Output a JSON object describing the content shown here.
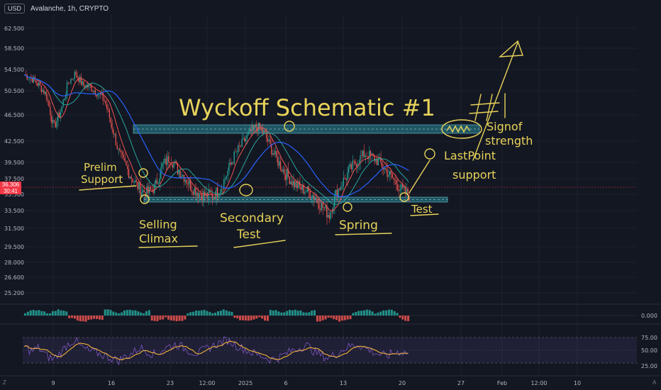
{
  "header": {
    "currency": "USD",
    "symbol_line": "Avalanche, 1h, CRYPTO"
  },
  "price_tag": {
    "value": "36.306",
    "countdown": "30:41"
  },
  "corner": {
    "left": "Z",
    "right": "A"
  },
  "colors": {
    "background": "#131722",
    "grid": "#1e222d",
    "annotation": "#e8d35a",
    "zone": "#2a8a9a",
    "ema": "#2962ff",
    "ma_teal": "#26a69a",
    "ma_red": "#ef5350",
    "rsi_line": "#7e57c2",
    "rsi_ma": "#f0b23a",
    "up": "#26a69a",
    "down": "#ef5350"
  },
  "chart_data": [
    {
      "type": "line",
      "title": "",
      "xlabel": "",
      "ylabel": "",
      "y_ticks": [
        "62.500",
        "58.500",
        "54.500",
        "50.500",
        "46.500",
        "42.500",
        "39.500",
        "37.500",
        "35.500",
        "33.500",
        "31.500",
        "29.500",
        "28.000",
        "26.600",
        "25.200"
      ],
      "x_ticks": [
        "9",
        "16",
        "23",
        "12:00",
        "2025",
        "6",
        "13",
        "20",
        "27",
        "Feb",
        "12:00",
        "10"
      ],
      "series": [
        {
          "values": [
            53.5,
            52.8,
            51.5,
            49.8,
            44.5,
            47.2,
            52.0,
            53.8,
            51.6,
            51.2,
            50.2,
            48.9,
            44.9,
            40.8,
            38.9,
            37.3,
            36.0,
            35.7,
            36.5,
            39.1,
            40.2,
            38.7,
            37.8,
            36.4,
            35.7,
            35.3,
            35.4,
            36.2,
            38.4,
            40.6,
            42.1,
            43.7,
            44.8,
            43.7,
            41.4,
            39.5,
            38.1,
            37.0,
            36.3,
            35.9,
            35.2,
            34.0,
            33.0,
            35.8,
            37.3,
            38.8,
            39.9,
            40.7,
            40.2,
            39.4,
            38.3,
            37.2,
            36.0,
            35.3
          ]
        }
      ]
    },
    {
      "type": "line",
      "title": "",
      "y_ticks": [
        "75.00",
        "50.00",
        "25.00"
      ],
      "ylim": [
        0,
        100
      ],
      "series": [
        {
          "values": [
            58,
            48,
            55,
            40,
            32,
            45,
            62,
            70,
            55,
            48,
            45,
            40,
            35,
            30,
            38,
            45,
            55,
            48,
            42,
            50,
            58,
            62,
            55,
            48,
            44,
            52,
            58,
            65,
            70,
            62,
            55,
            48,
            42,
            38,
            32,
            35,
            42,
            50,
            55,
            60,
            48,
            40,
            35,
            42,
            52,
            58,
            62,
            55,
            48,
            42,
            38,
            45,
            48,
            44
          ]
        }
      ]
    },
    {
      "type": "bar",
      "title": "",
      "y_ticks": [
        "0.000"
      ]
    }
  ],
  "annotations": {
    "title": "Wyckoff Schematic #1",
    "prelim": [
      "Prelim",
      "Support"
    ],
    "climax": [
      "Selling",
      "Climax"
    ],
    "secondary": [
      "Secondary",
      "Test"
    ],
    "spring": "Spring",
    "test": "Test",
    "lps": [
      "LastPoint",
      "support"
    ],
    "sos": [
      "Signof",
      "strength"
    ]
  }
}
